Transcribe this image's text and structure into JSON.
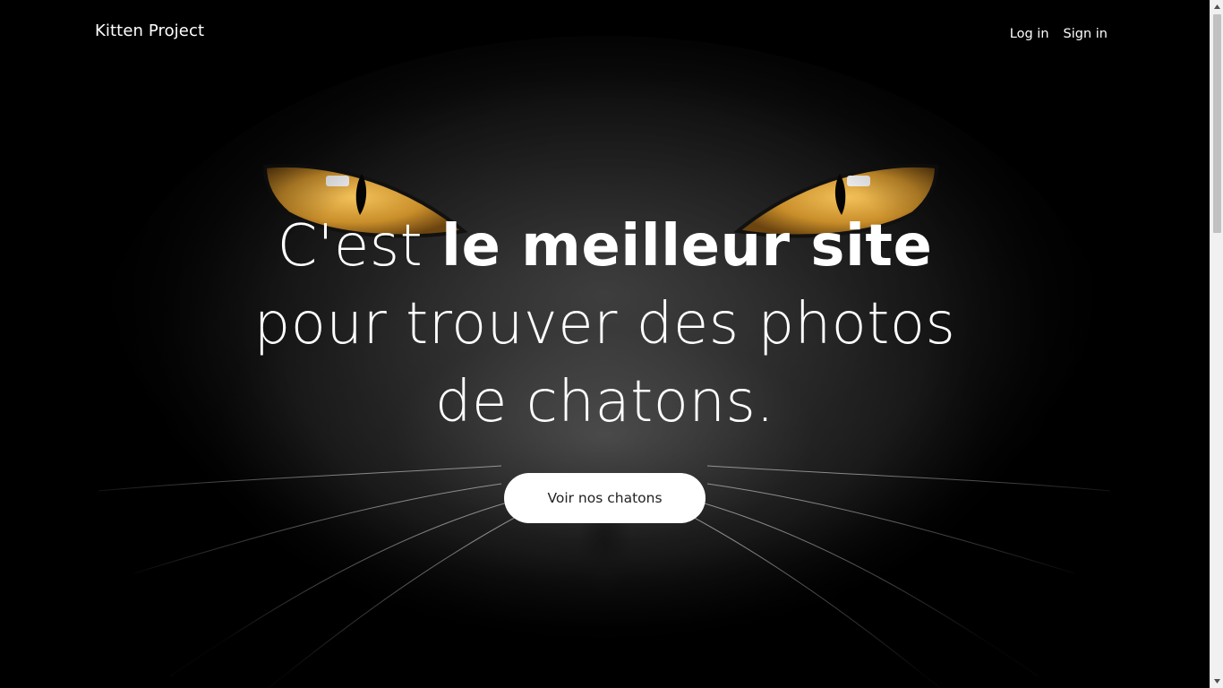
{
  "navbar": {
    "brand": "Kitten Project",
    "links": [
      {
        "label": "Log in"
      },
      {
        "label": "Sign in"
      }
    ]
  },
  "hero": {
    "headline_part1": "C'est ",
    "headline_bold": "le meilleur site",
    "headline_line2": "pour trouver des photos",
    "headline_line3": "de chatons.",
    "cta_label": "Voir nos chatons",
    "background_image": "black-cat-face-with-amber-eyes"
  },
  "colors": {
    "background": "#000000",
    "text": "#ffffff",
    "button_bg": "#ffffff",
    "button_text": "#222222",
    "eye": "#d9a53a"
  }
}
